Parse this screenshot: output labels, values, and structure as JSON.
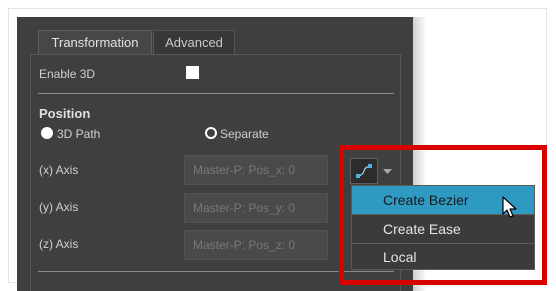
{
  "tabs": [
    {
      "label": "Transformation",
      "active": true
    },
    {
      "label": "Advanced",
      "active": false
    }
  ],
  "enable_3d": {
    "label": "Enable 3D",
    "checked": false
  },
  "position": {
    "heading": "Position",
    "options": [
      {
        "label": "3D Path",
        "selected": true
      },
      {
        "label": "Separate",
        "selected": false
      }
    ]
  },
  "axes": [
    {
      "label": "(x) Axis",
      "placeholder": "Master-P: Pos_x: 0"
    },
    {
      "label": "(y) Axis",
      "placeholder": "Master-P: Pos_y: 0"
    },
    {
      "label": "(z) Axis",
      "placeholder": "Master-P: Pos_z: 0"
    }
  ],
  "function_menu": {
    "button_icon": "bezier-curve-icon",
    "arrow_icon": "chevron-down-icon",
    "items": [
      {
        "label": "Create Bezier",
        "highlighted": true
      },
      {
        "label": "Create Ease",
        "highlighted": false
      },
      {
        "label": "Local",
        "highlighted": false
      }
    ]
  },
  "colors": {
    "panel_bg": "#3f3f3f",
    "menu_highlight": "#2e9ac2",
    "callout_red": "#d90000"
  }
}
